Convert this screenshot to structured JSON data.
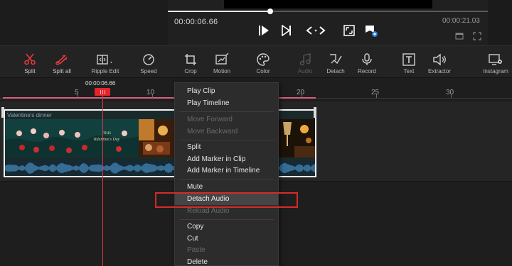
{
  "player": {
    "current_time": "00:00:06.66",
    "total_time": "00:00:21.03",
    "progress": 0.32
  },
  "toolbar": {
    "items": [
      {
        "label": "Split",
        "icon": "scissors-icon"
      },
      {
        "label": "Split all",
        "icon": "split-all-icon"
      },
      {
        "label": "Ripple Edit",
        "icon": "ripple-edit-icon"
      },
      {
        "label": "Speed",
        "icon": "speedometer-icon"
      },
      {
        "label": "Crop",
        "icon": "crop-icon"
      },
      {
        "label": "Motion",
        "icon": "motion-icon"
      },
      {
        "label": "Color",
        "icon": "palette-icon"
      },
      {
        "label": "Audio",
        "icon": "audio-icon"
      },
      {
        "label": "Detach",
        "icon": "detach-icon"
      },
      {
        "label": "Record",
        "icon": "microphone-icon"
      },
      {
        "label": "Text",
        "icon": "text-icon"
      },
      {
        "label": "Extractor",
        "icon": "extractor-icon"
      },
      {
        "label": "Instagram",
        "icon": "instagram-icon"
      }
    ]
  },
  "timeline": {
    "playhead_time": "00:00:06.66",
    "ruler_labels": [
      "5",
      "10",
      "20",
      "25",
      "30"
    ],
    "clip_title": "Valentine's dinner"
  },
  "context_menu": {
    "items": [
      {
        "label": "Play Clip",
        "enabled": true
      },
      {
        "label": "Play Timeline",
        "enabled": true
      },
      {
        "label": "Move Forward",
        "enabled": false
      },
      {
        "label": "Move Backward",
        "enabled": false
      },
      {
        "label": "Split",
        "enabled": true
      },
      {
        "label": "Add Marker in Clip",
        "enabled": true
      },
      {
        "label": "Add Marker in Timeline",
        "enabled": true
      },
      {
        "label": "Mute",
        "enabled": true
      },
      {
        "label": "Detach Audio",
        "enabled": true,
        "hovered": true
      },
      {
        "label": "Reload Audio",
        "enabled": false
      },
      {
        "label": "Copy",
        "enabled": true
      },
      {
        "label": "Cut",
        "enabled": true
      },
      {
        "label": "Paste",
        "enabled": false
      },
      {
        "label": "Delete",
        "enabled": true
      }
    ]
  },
  "colors": {
    "accent_red": "#e0262c",
    "highlight_box": "#d42b2b",
    "ruler_accent": "#d9607a"
  }
}
